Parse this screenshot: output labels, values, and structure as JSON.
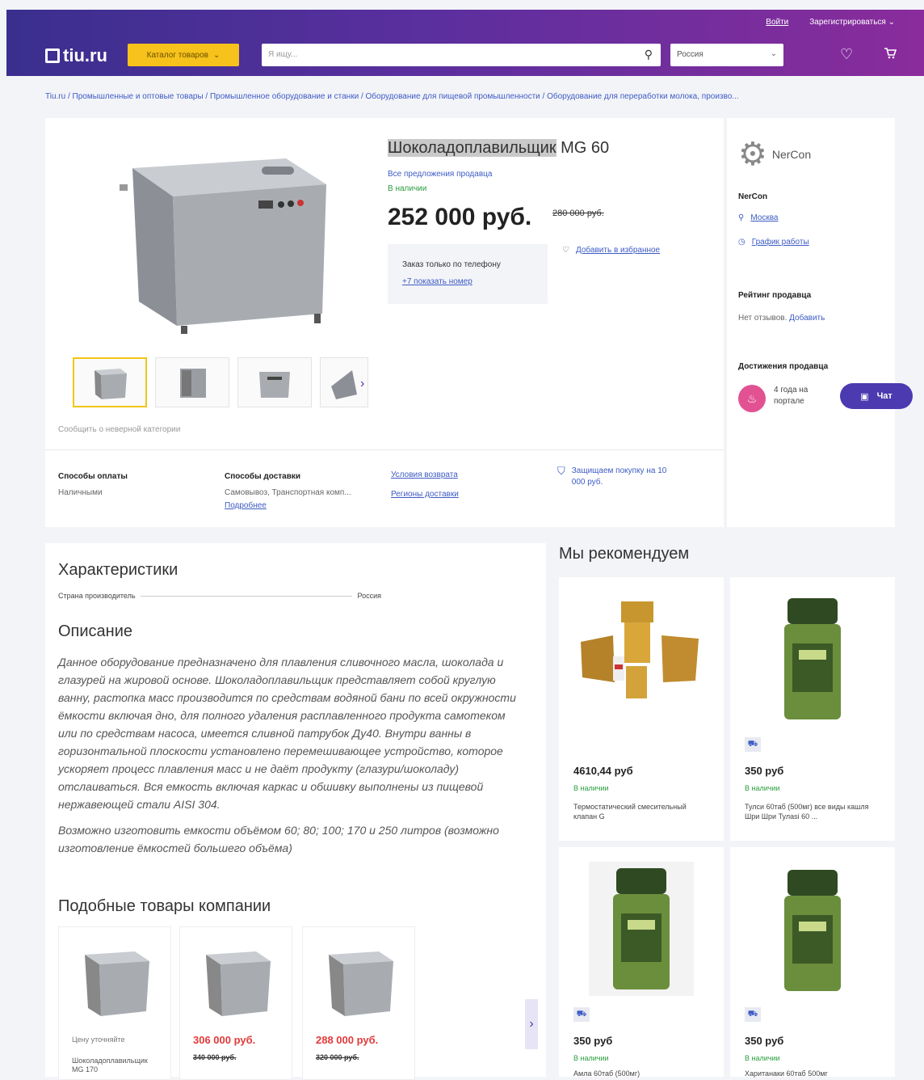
{
  "header": {
    "login": "Войти",
    "register": "Зарегистрироваться",
    "logo": "tiu.ru",
    "catalog": "Каталог товаров",
    "search_placeholder": "Я ищу...",
    "region": "Россия"
  },
  "breadcrumb": "Tiu.ru / Промышленные и оптовые товары / Промышленное оборудование и станки / Оборудование для пищевой промышленности / Оборудование для переработки молока, произво...",
  "product": {
    "title_highlight": "Шоколадоплавильщик",
    "title_rest": " MG 60",
    "all_offers": "Все предложения продавца",
    "stock": "В наличии",
    "price": "252 000 руб.",
    "old_price": "280 000 руб.",
    "phone_note": "Заказ только по телефону",
    "phone_link": "+7 показать номер",
    "add_favorite": "Добавить в избранное",
    "report": "Сообщить о неверной категории"
  },
  "info": {
    "payment_title": "Способы оплаты",
    "payment_value": "Наличными",
    "delivery_title": "Способы доставки",
    "delivery_value": "Самовывоз, Транспортная комп...",
    "delivery_more": "Подробнее",
    "return_link": "Условия возврата",
    "regions_link": "Регионы доставки",
    "protection": "Защищаем покупку на 10 000 руб."
  },
  "seller": {
    "logo_text": "NerCon",
    "name": "NerCon",
    "city": "Москва",
    "hours": "График работы",
    "rating_title": "Рейтинг продавца",
    "rating_text": "Нет отзывов.",
    "rating_add": "Добавить",
    "ach_title": "Достижения продавца",
    "ach_text": "4 года на портале"
  },
  "chat": "Чат",
  "specs": {
    "title": "Характеристики",
    "row_label": "Страна производитель",
    "row_value": "Россия"
  },
  "description": {
    "title": "Описание",
    "p1": "Данное оборудование предназначено для плавления сливочного масла, шоколада и глазурей на жировой основе. Шоколадоплавильщик представляет собой круглую ванну, растопка масс производится по средствам водяной бани по всей окружности ёмкости включая дно, для полного удаления расплавленного продукта самотеком или по средствам насоса, имеется сливной патрубок Ду40. Внутри ванны в горизонтальной плоскости установлено перемешивающее устройство, которое ускоряет процесс плавления масс и не даёт продукту (глазури/шоколаду) отслаиваться. Вся емкость включая каркас и обшивку выполнены из пищевой нержавеющей стали AISI 304.",
    "p2": "Возможно изготовить емкости объёмом 60; 80; 100; 170 и 250 литров (возможно изготовление ёмкостей большего объёма)"
  },
  "similar": {
    "title": "Подобные товары компании",
    "items": [
      {
        "price": "Цену уточняйте",
        "name": "Шоколадоплавильщик MG 170"
      },
      {
        "price": "306 000 руб.",
        "old": "340 000 руб."
      },
      {
        "price": "288 000 руб.",
        "old": "320 000 руб."
      }
    ]
  },
  "recommend": {
    "title": "Мы рекомендуем",
    "items": [
      {
        "price": "4610,44 руб",
        "stock": "В наличии",
        "name": "Термостатический смесительный клапан G"
      },
      {
        "price": "350 руб",
        "stock": "В наличии",
        "name": "Тулси 60таб (500мг) все виды кашля Шри Шри Тулаsi 60 ..."
      },
      {
        "price": "350 руб",
        "stock": "В наличии",
        "name": "Амла 60таб (500мг)"
      },
      {
        "price": "350 руб",
        "stock": "В наличии",
        "name": "Хаританаки 60таб 500мг"
      }
    ]
  },
  "colors": {
    "accent": "#5a2f9e",
    "catalog": "#f6c21b",
    "price_red": "#e23a3a",
    "link": "#3d5bc4",
    "stock": "#2a9d3f"
  }
}
